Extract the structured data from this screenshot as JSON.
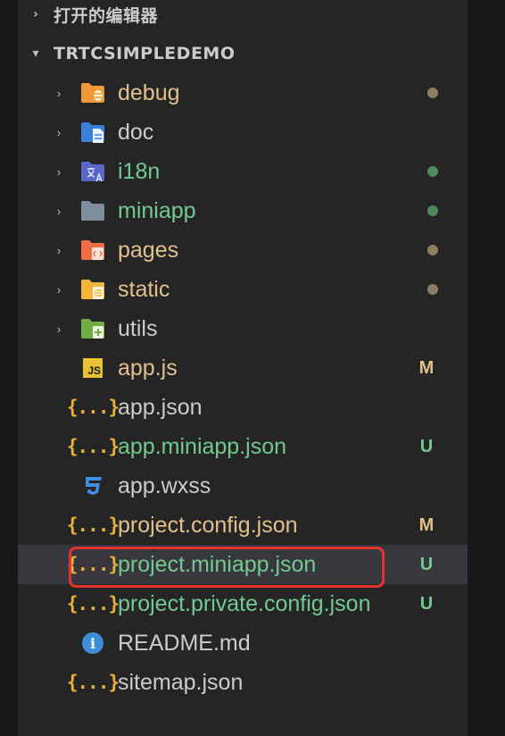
{
  "sections": {
    "open_editors": {
      "label": "打开的编辑器",
      "chevron": "›"
    },
    "project": {
      "label": "TRTCSIMPLEDEMO",
      "chevron": "▾"
    }
  },
  "tree_chevron": "›",
  "folders": [
    {
      "name": "debug",
      "icon": "folder-debug-icon",
      "color": "#f09a3a",
      "status": "dot",
      "status_color": "#8c7d63",
      "label_style": "modified"
    },
    {
      "name": "doc",
      "icon": "folder-doc-icon",
      "color": "#3a7fd8",
      "status": "",
      "label_style": "plain"
    },
    {
      "name": "i18n",
      "icon": "folder-i18n-icon",
      "color": "#5a67c9",
      "status": "dot",
      "status_color": "#4f8a5f",
      "label_style": "new"
    },
    {
      "name": "miniapp",
      "icon": "folder-icon",
      "color": "#7f8e9c",
      "status": "dot",
      "status_color": "#4f8a5f",
      "label_style": "new"
    },
    {
      "name": "pages",
      "icon": "folder-pages-icon",
      "color": "#ef6d45",
      "status": "dot",
      "status_color": "#8c7d63",
      "label_style": "modified"
    },
    {
      "name": "static",
      "icon": "folder-static-icon",
      "color": "#f3b63a",
      "status": "dot",
      "status_color": "#8c7d63",
      "label_style": "modified"
    },
    {
      "name": "utils",
      "icon": "folder-utils-icon",
      "color": "#6fae45",
      "status": "",
      "label_style": "plain"
    }
  ],
  "files": [
    {
      "name": "app.js",
      "icon": "js-file-icon",
      "icon_text": "JS",
      "status": "M",
      "label_style": "modified"
    },
    {
      "name": "app.json",
      "icon": "json-file-icon",
      "icon_text": "{...}",
      "status": "",
      "label_style": "plain"
    },
    {
      "name": "app.miniapp.json",
      "icon": "json-file-icon",
      "icon_text": "{...}",
      "status": "U",
      "label_style": "new"
    },
    {
      "name": "app.wxss",
      "icon": "css-file-icon",
      "icon_text": "",
      "status": "",
      "label_style": "plain"
    },
    {
      "name": "project.config.json",
      "icon": "json-file-icon",
      "icon_text": "{...}",
      "status": "M",
      "label_style": "modified"
    },
    {
      "name": "project.miniapp.json",
      "icon": "json-file-icon",
      "icon_text": "{...}",
      "status": "U",
      "label_style": "new",
      "selected": true
    },
    {
      "name": "project.private.config.json",
      "icon": "json-file-icon",
      "icon_text": "{...}",
      "status": "U",
      "label_style": "new"
    },
    {
      "name": "README.md",
      "icon": "info-file-icon",
      "icon_text": "i",
      "status": "",
      "label_style": "plain"
    },
    {
      "name": "sitemap.json",
      "icon": "json-file-icon",
      "icon_text": "{...}",
      "status": "",
      "label_style": "plain"
    }
  ],
  "colors": {
    "modified": "#e2c08d",
    "untracked": "#73c991",
    "plain": "#cccccc",
    "selection": "#37373d",
    "annotation": "#e3342f"
  }
}
